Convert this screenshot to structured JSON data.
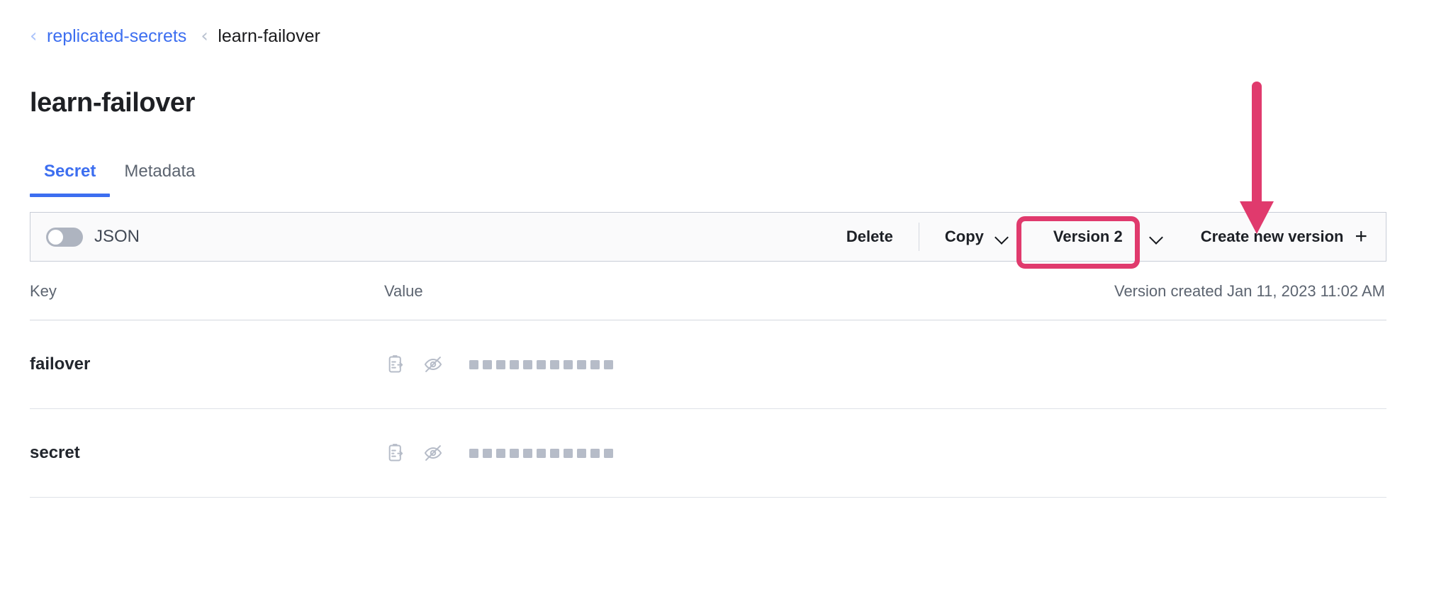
{
  "breadcrumb": {
    "chevron_icon": "chevron-left-icon",
    "parent": "replicated-secrets",
    "current": "learn-failover"
  },
  "page_title": "learn-failover",
  "tabs": [
    {
      "label": "Secret",
      "active": true
    },
    {
      "label": "Metadata",
      "active": false
    }
  ],
  "toolbar": {
    "json_toggle": {
      "label": "JSON",
      "state": "off"
    },
    "delete_label": "Delete",
    "copy_label": "Copy",
    "copy_chevron_icon": "chevron-down-icon",
    "version_label": "Version 2",
    "version_chevron_icon": "chevron-down-icon",
    "create_label": "Create new version",
    "create_plus_icon": "plus-icon"
  },
  "annotation": {
    "highlight_color": "#e03a6d",
    "arrow_color": "#e03a6d",
    "highlight_target": "Version 2",
    "arrow_target": "Create new version"
  },
  "table": {
    "headers": {
      "key": "Key",
      "value": "Value"
    },
    "version_created": "Version created Jan 11, 2023 11:02 AM",
    "rows": [
      {
        "key": "failover",
        "copy_icon": "copy-clipboard-icon",
        "reveal_icon": "eye-off-icon",
        "value_masked": true,
        "mask_count": 11
      },
      {
        "key": "secret",
        "copy_icon": "copy-clipboard-icon",
        "reveal_icon": "eye-off-icon",
        "value_masked": true,
        "mask_count": 11
      }
    ]
  },
  "colors": {
    "accent_blue": "#3c6ef0",
    "annotation_pink": "#e03a6d",
    "text_dark": "#1d2026",
    "text_muted": "#5c6470",
    "mask_gray": "#b6bcc8"
  }
}
